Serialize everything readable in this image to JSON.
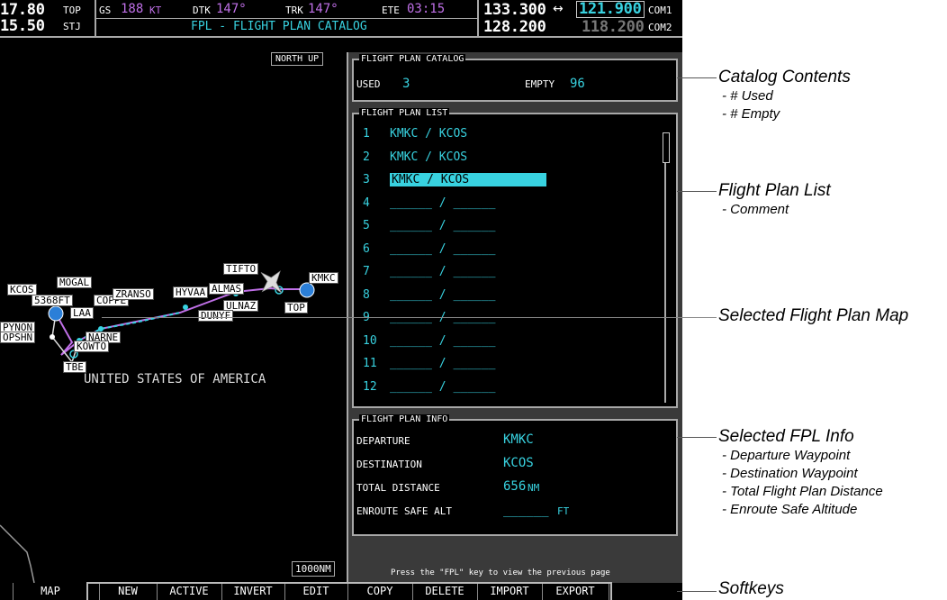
{
  "topbar": {
    "freq1": "17.80",
    "wpt1": "TOP",
    "freq2": "15.50",
    "wpt2": "STJ",
    "gs_label": "GS",
    "gs_value": "188",
    "gs_unit": "KT",
    "dtk_label": "DTK",
    "dtk_value": "147°",
    "trk_label": "TRK",
    "trk_value": "147°",
    "ete_label": "ETE",
    "ete_value": "03:15",
    "page_title": "FPL - FLIGHT PLAN CATALOG",
    "com1_active": "133.300",
    "com1_swap": "↔",
    "com1_standby": "121.900",
    "com1_label": "COM1",
    "com2_active": "128.200",
    "com2_standby": "118.200",
    "com2_label": "COM2"
  },
  "map": {
    "orientation": "NORTH UP",
    "range": "1000NM",
    "country": "UNITED STATES OF AMERICA",
    "labels": {
      "kcos": "KCOS",
      "mogal": "MOGAL",
      "ft": "5368FT",
      "tifto": "TIFTO",
      "kmkc": "KMKC",
      "top": "TOP",
      "coppe": "COPPE",
      "ranso": "ZRANSO",
      "hyvaa": "HYVAA",
      "almas": "ALMAS",
      "ulnaz": "ULNAZ",
      "dunyf": "DUNYF",
      "laa": "LAA",
      "pynon": "PYNON",
      "opshn": "OPSHN",
      "narne": "NARNE",
      "kowto": "KOWTO",
      "tbe": "TBE"
    }
  },
  "catalog": {
    "title": "FLIGHT PLAN CATALOG",
    "used_label": "USED",
    "used_value": "3",
    "empty_label": "EMPTY",
    "empty_value": "96"
  },
  "fpl_list": {
    "title": "FLIGHT PLAN LIST",
    "rows": [
      {
        "num": "1",
        "name": "KMKC / KCOS"
      },
      {
        "num": "2",
        "name": "KMKC / KCOS"
      },
      {
        "num": "3",
        "name": "KMKC / KCOS"
      },
      {
        "num": "4",
        "name": "______ / ______"
      },
      {
        "num": "5",
        "name": "______ / ______"
      },
      {
        "num": "6",
        "name": "______ / ______"
      },
      {
        "num": "7",
        "name": "______ / ______"
      },
      {
        "num": "8",
        "name": "______ / ______"
      },
      {
        "num": "9",
        "name": "______ / ______"
      },
      {
        "num": "10",
        "name": "______ / ______"
      },
      {
        "num": "11",
        "name": "______ / ______"
      },
      {
        "num": "12",
        "name": "______ / ______"
      }
    ]
  },
  "fpl_info": {
    "title": "FLIGHT PLAN INFO",
    "departure_label": "DEPARTURE",
    "departure_value": "KMKC",
    "destination_label": "DESTINATION",
    "destination_value": "KCOS",
    "distance_label": "TOTAL DISTANCE",
    "distance_value": "656",
    "distance_unit": "NM",
    "esa_label": "ENROUTE SAFE ALT",
    "esa_value": "______",
    "esa_unit": "FT"
  },
  "footer_hint": "Press the \"FPL\" key to view the previous page",
  "softkeys": [
    "MAP",
    "NEW",
    "ACTIVE",
    "INVERT",
    "EDIT",
    "COPY",
    "DELETE",
    "IMPORT",
    "EXPORT"
  ],
  "callouts": {
    "catalog": {
      "title": "Catalog Contents",
      "items": [
        "- # Used",
        "- # Empty"
      ]
    },
    "list": {
      "title": "Flight Plan List",
      "items": [
        "- Comment"
      ]
    },
    "map": {
      "title": "Selected Flight Plan Map"
    },
    "info": {
      "title": "Selected FPL Info",
      "items": [
        "- Departure Waypoint",
        "- Destination Waypoint",
        "- Total Flight Plan Distance",
        "- Enroute Safe Altitude"
      ]
    },
    "softkeys": {
      "title": "Softkeys"
    }
  },
  "colors": {
    "cyan": "#38d2e0",
    "magenta": "#c070e8",
    "highlight": "#38d2e0"
  }
}
